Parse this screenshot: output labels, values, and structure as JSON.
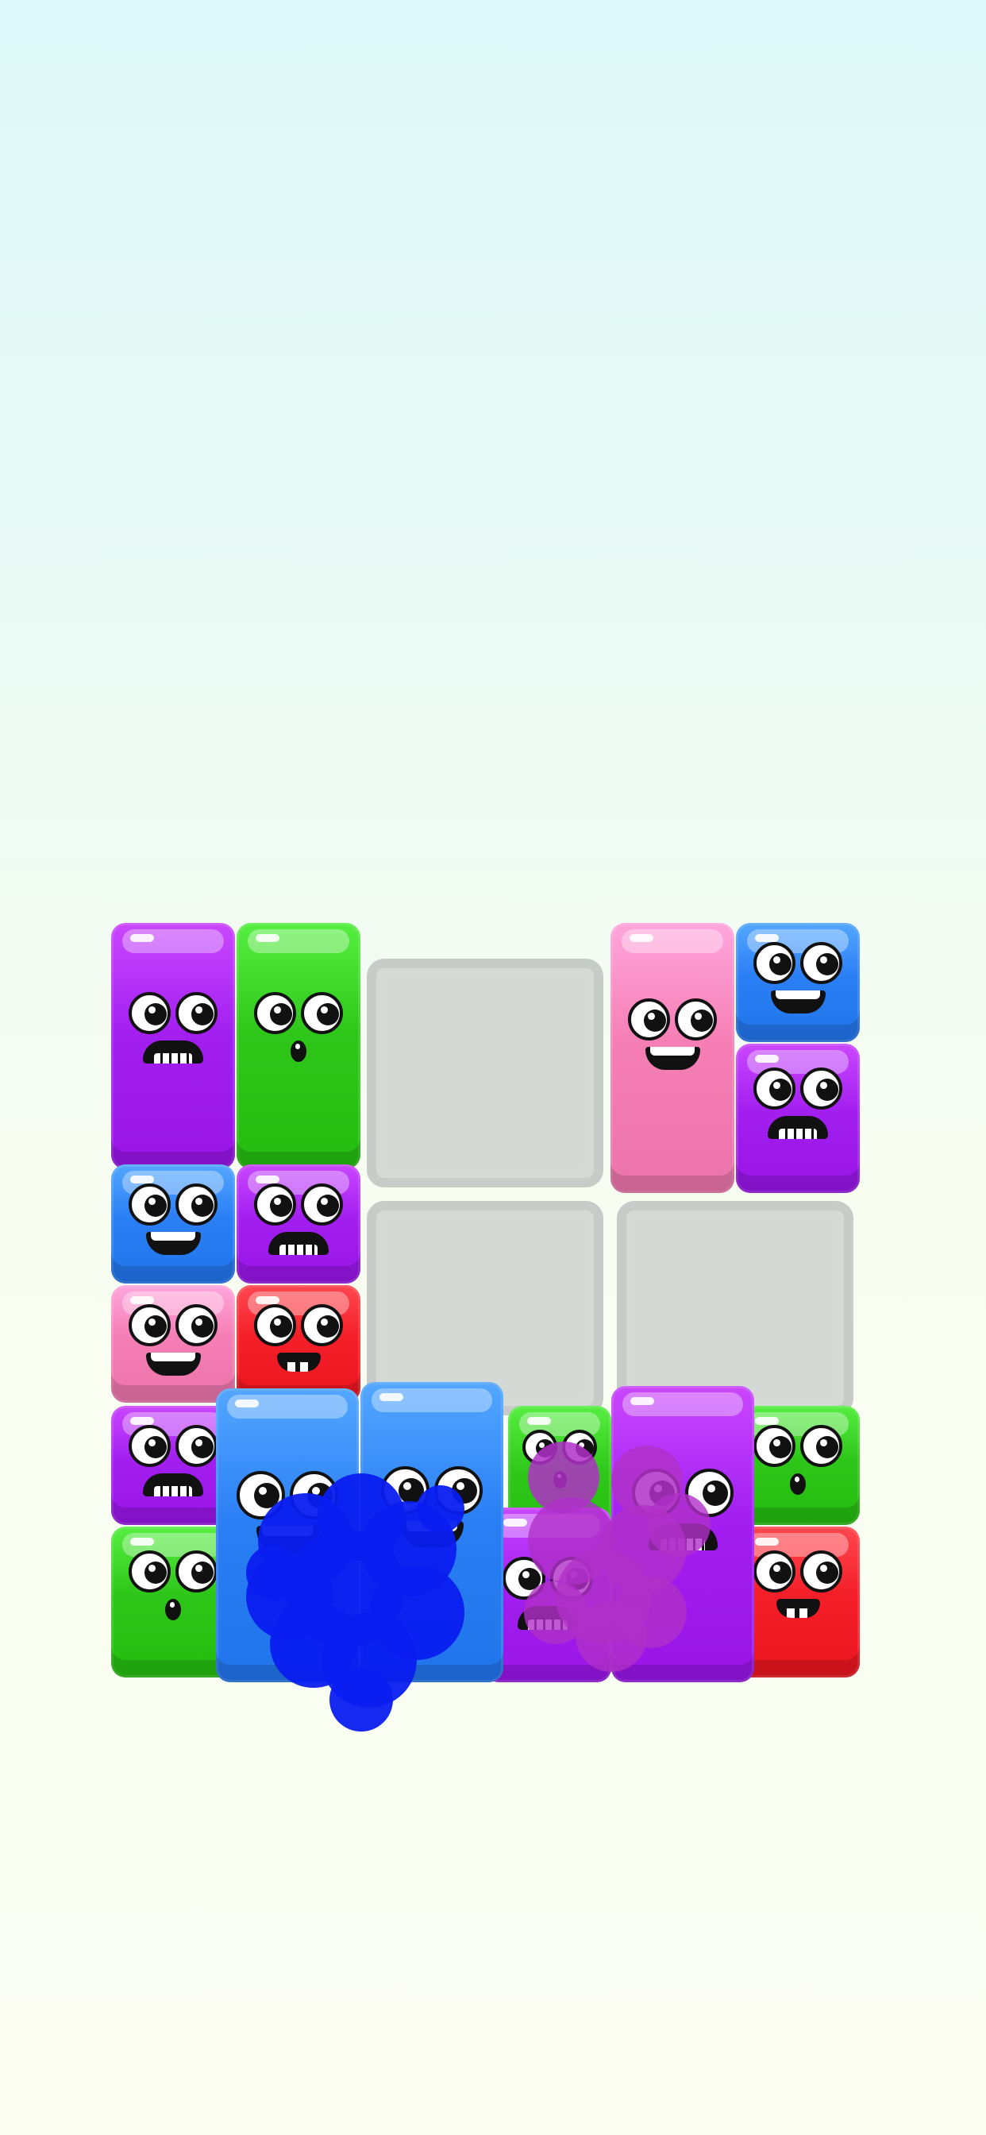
{
  "game": {
    "palette": {
      "purple": "#a21ff0",
      "green": "#2fc61a",
      "blue": "#2b7ff5",
      "pink": "#f57eb4",
      "red": "#f41f28",
      "empty_slot": "#d6dad7"
    },
    "splash_colors": {
      "blue": "#0a1ef0",
      "magenta": "#b030c8"
    },
    "board": {
      "empty_slots": 3,
      "blocks": [
        {
          "color": "purple",
          "mood": "scared"
        },
        {
          "color": "green",
          "mood": "surprised"
        },
        {
          "color": "pink",
          "mood": "happy"
        },
        {
          "color": "blue",
          "mood": "happy"
        },
        {
          "color": "purple",
          "mood": "scared"
        },
        {
          "color": "blue",
          "mood": "happy"
        },
        {
          "color": "purple",
          "mood": "scared"
        },
        {
          "color": "pink",
          "mood": "happy"
        },
        {
          "color": "red",
          "mood": "grin"
        },
        {
          "color": "purple",
          "mood": "scared"
        },
        {
          "color": "green",
          "mood": "surprised"
        },
        {
          "color": "green",
          "mood": "surprised"
        },
        {
          "color": "red",
          "mood": "grin"
        },
        {
          "color": "green",
          "mood": "surprised"
        },
        {
          "color": "purple",
          "mood": "scared"
        },
        {
          "color": "blue",
          "mood": "happy"
        },
        {
          "color": "blue",
          "mood": "happy"
        },
        {
          "color": "purple",
          "mood": "scared"
        }
      ]
    }
  }
}
